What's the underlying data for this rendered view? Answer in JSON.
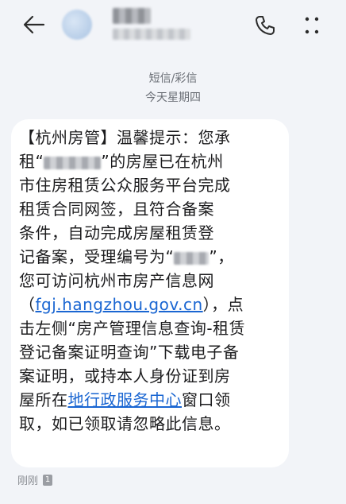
{
  "header": {
    "back_icon": "arrow-left-icon",
    "phone_icon": "phone-icon",
    "more_icon": "more-vertical-icon"
  },
  "thread": {
    "message_type": "短信/彩信",
    "date": "今天星期四"
  },
  "message": {
    "lines": [
      [
        "【杭州房管】温馨提示：您承"
      ],
      [
        "租“",
        "”的房屋已在杭州"
      ],
      [
        "市住房租赁公众服务平台完成"
      ],
      [
        "租赁合同网签，且符合备案"
      ],
      [
        "条件，自动完成房屋租赁登"
      ],
      [
        "记备案，受理编号为“",
        "”，"
      ],
      [
        "您可访问杭州市房产信息网"
      ],
      [
        "（",
        "fgj.hangzhou.gov.cn",
        "），点"
      ],
      [
        "击左侧“房产管理信息查询-租赁"
      ],
      [
        "登记备案证明查询”下载电子备"
      ],
      [
        "案证明，或持本人身份证到房"
      ],
      [
        "屋所在",
        "地行政服务中心",
        "窗口领"
      ],
      [
        "取，如已领取请忽略此信息。"
      ]
    ]
  },
  "footer": {
    "time": "刚刚",
    "sim": "1"
  },
  "colors": {
    "background": "#f2f4f8",
    "bubble": "#ffffff",
    "link": "#1a66d2",
    "meta_text": "#6b6f76"
  }
}
